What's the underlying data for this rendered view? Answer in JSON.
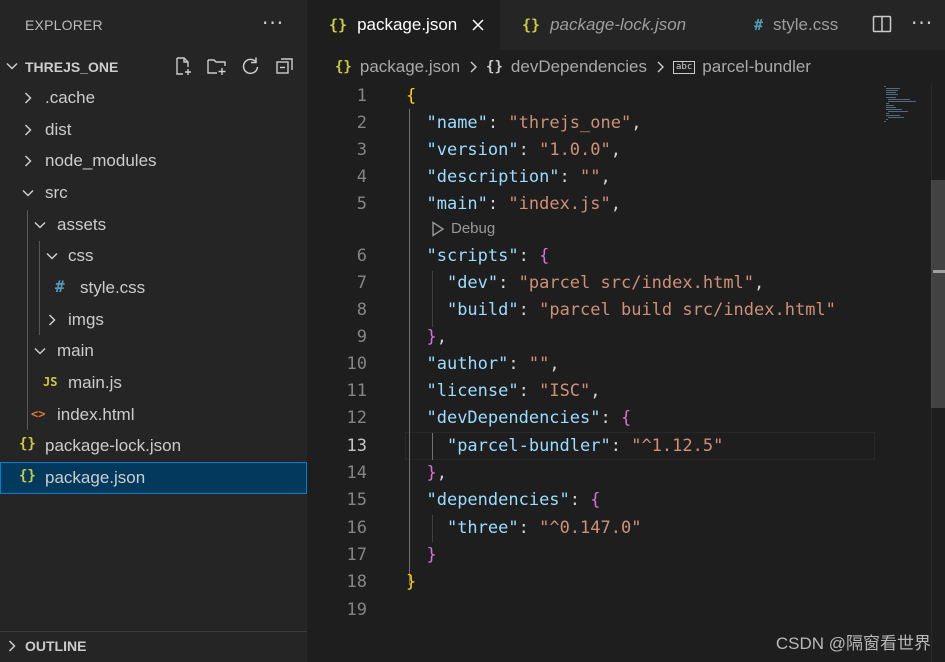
{
  "sidebar": {
    "title": "EXPLORER",
    "more": "···",
    "project": "THREJS_ONE",
    "tree": [
      {
        "label": ".cache",
        "kind": "folder-closed"
      },
      {
        "label": "dist",
        "kind": "folder-closed"
      },
      {
        "label": "node_modules",
        "kind": "folder-closed"
      },
      {
        "label": "src",
        "kind": "folder-open"
      },
      {
        "label": "assets",
        "kind": "folder-open"
      },
      {
        "label": "css",
        "kind": "folder-open"
      },
      {
        "label": "style.css",
        "kind": "file",
        "icon": "#"
      },
      {
        "label": "imgs",
        "kind": "folder-closed"
      },
      {
        "label": "main",
        "kind": "folder-open"
      },
      {
        "label": "main.js",
        "kind": "file",
        "icon": "JS"
      },
      {
        "label": "index.html",
        "kind": "file",
        "icon": "<>"
      },
      {
        "label": "package-lock.json",
        "kind": "file",
        "icon": "{}"
      },
      {
        "label": "package.json",
        "kind": "file",
        "icon": "{}",
        "selected": true
      }
    ],
    "outline": "OUTLINE"
  },
  "tabs": [
    {
      "label": "package.json",
      "icon": "{}",
      "active": true
    },
    {
      "label": "package-lock.json",
      "icon": "{}",
      "italic": true
    },
    {
      "label": "style.css",
      "icon": "#"
    }
  ],
  "tab_more": "···",
  "breadcrumb": {
    "file": "package.json",
    "obj_icon": "{}",
    "section": "devDependencies",
    "leaf_icon": "abc",
    "leaf": "parcel-bundler"
  },
  "editor": {
    "line_numbers": [
      "1",
      "2",
      "3",
      "4",
      "5",
      "6",
      "7",
      "8",
      "9",
      "10",
      "11",
      "12",
      "13",
      "14",
      "15",
      "16",
      "17",
      "18",
      "19"
    ],
    "current_line": "13",
    "codelens": "Debug",
    "keys": {
      "name": "\"name\"",
      "version": "\"version\"",
      "description": "\"description\"",
      "main": "\"main\"",
      "scripts": "\"scripts\"",
      "dev": "\"dev\"",
      "build": "\"build\"",
      "author": "\"author\"",
      "license": "\"license\"",
      "devDependencies": "\"devDependencies\"",
      "parcel_bundler": "\"parcel-bundler\"",
      "dependencies": "\"dependencies\"",
      "three": "\"three\""
    },
    "values": {
      "name": "\"threjs_one\"",
      "version": "\"1.0.0\"",
      "description": "\"\"",
      "main": "\"index.js\"",
      "dev": "\"parcel src/index.html\"",
      "build": "\"parcel build src/index.html\"",
      "author": "\"\"",
      "license": "\"ISC\"",
      "parcel_bundler": "\"^1.12.5\"",
      "three": "\"^0.147.0\""
    }
  },
  "watermark": "CSDN @隔窗看世界",
  "colors": {
    "json_icon": "#cbcb41",
    "css_icon": "#519aba",
    "js_icon": "#cbcb41",
    "html_icon": "#e37933",
    "selection": "#04395e"
  }
}
